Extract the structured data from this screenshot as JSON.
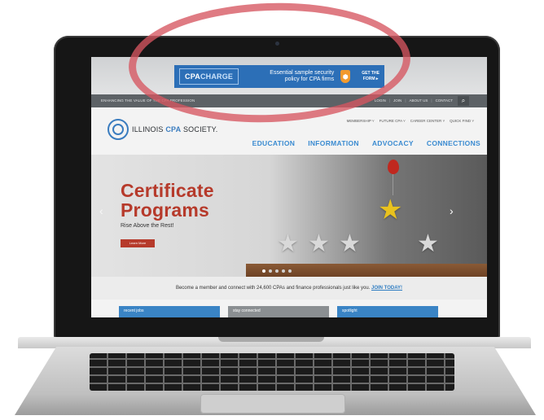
{
  "ad": {
    "logo_prefix": "CPA",
    "logo_suffix": "CHARGE",
    "copy_line1": "Essential sample security",
    "copy_line2": "policy for CPA firms",
    "cta_line1": "GET THE",
    "cta_line2": "FORM ▸"
  },
  "topbar": {
    "tagline": "ENHANCING THE VALUE OF THE CPA PROFESSION",
    "links": [
      "LOGIN",
      "JOIN",
      "ABOUT US",
      "CONTACT"
    ],
    "search_icon": "search-icon"
  },
  "header": {
    "logo_pre": "ILLINOIS ",
    "logo_bold": "CPA",
    "logo_post": " SOCIETY.",
    "subnav": [
      "MEMBERSHIP ˅",
      "FUTURE CPA ˅",
      "CAREER CENTER ˅",
      "QUICK FIND ˅"
    ],
    "mainnav": [
      "EDUCATION",
      "INFORMATION",
      "ADVOCACY",
      "CONNECTIONS"
    ]
  },
  "hero": {
    "title_line1": "Certificate",
    "title_line2": "Programs",
    "subtitle": "Rise Above the Rest!",
    "button": "Learn More",
    "prev_icon": "chevron-left-icon",
    "next_icon": "chevron-right-icon",
    "slide_count": 5,
    "active_slide": 1
  },
  "promo": {
    "text": "Become a member and connect with 24,600 CPAs and finance professionals just like you.",
    "link": "JOIN TODAY!"
  },
  "tiles": [
    "recent jobs",
    "stay connected",
    "spotlight"
  ],
  "colors": {
    "brand_blue": "#3a7cbf",
    "hero_red": "#b63a2b",
    "highlight": "#d65660"
  }
}
